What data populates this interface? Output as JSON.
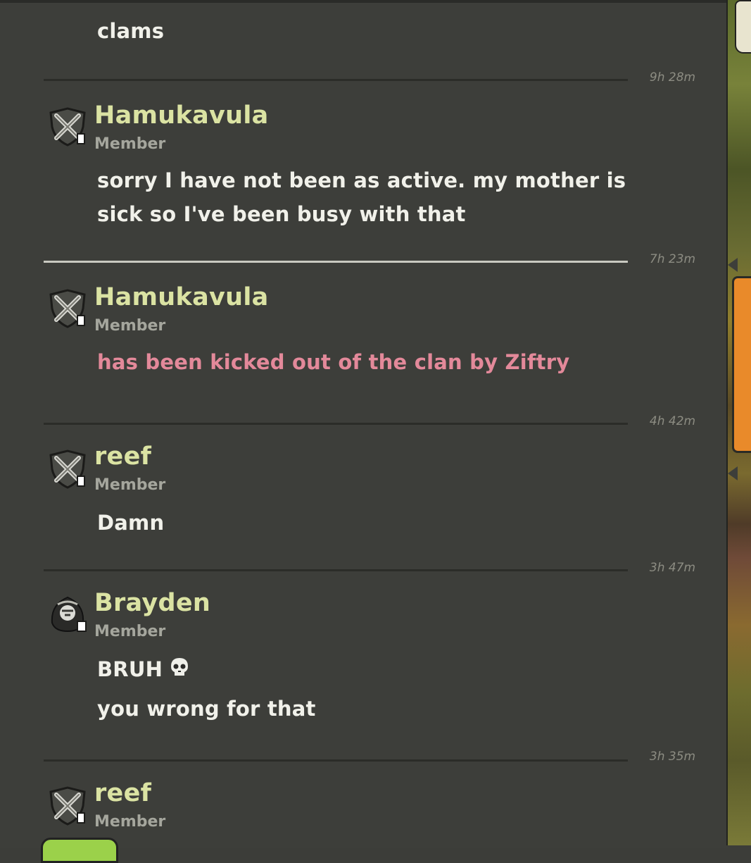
{
  "messages": [
    {
      "text_lines": [
        "clams"
      ]
    },
    {
      "time": "9h 28m",
      "name": "Hamukavula",
      "role": "Member",
      "text_lines": [
        "sorry I have not been as active. my mother is",
        "sick so I've been busy with that"
      ]
    },
    {
      "time": "7h 23m",
      "name": "Hamukavula",
      "role": "Member",
      "text_lines": [
        "has been kicked out of the clan by Ziftry"
      ]
    },
    {
      "time": "4h 42m",
      "name": "reef",
      "role": "Member",
      "text_lines": [
        "Damn"
      ]
    },
    {
      "time": "3h 47m",
      "name": "Brayden",
      "role": "Member",
      "text_lines": [
        "BRUH",
        "you wrong for that"
      ]
    },
    {
      "time": "3h 35m",
      "name": "reef",
      "role": "Member",
      "text_lines": []
    }
  ],
  "icons": {
    "member_badge": "crossed-swords-icon",
    "brayden_avatar": "hooded-warrior-icon",
    "emoji": "skull-icon"
  },
  "colors": {
    "background": "#3d3e3a",
    "name": "#dbe3a3",
    "message": "#f1f1ea",
    "system_message": "#e3899a",
    "role": "#a5a69d",
    "timestamp": "#8c8c82"
  }
}
